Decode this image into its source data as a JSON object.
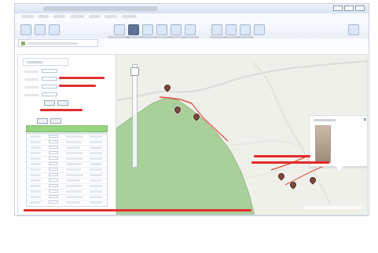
{
  "window": {
    "title": "",
    "menu_items": [
      "",
      "",
      "",
      "",
      "",
      "",
      ""
    ],
    "toolbar_items": [
      "",
      "",
      "",
      "",
      "",
      "",
      "",
      "",
      ""
    ],
    "tabs": [
      ""
    ]
  },
  "left_panel": {
    "heading": "",
    "fields": [
      "",
      "",
      "",
      ""
    ],
    "notes": [
      "",
      "",
      ""
    ],
    "buttons": [
      "",
      "",
      "",
      ""
    ],
    "table_header": "",
    "rows": [
      [
        "",
        "",
        ""
      ],
      [
        "",
        "",
        ""
      ],
      [
        "",
        "",
        ""
      ],
      [
        "",
        "",
        ""
      ],
      [
        "",
        "",
        ""
      ],
      [
        "",
        "",
        ""
      ],
      [
        "",
        "",
        ""
      ],
      [
        "",
        "",
        ""
      ],
      [
        "",
        "",
        ""
      ],
      [
        "",
        "",
        ""
      ],
      [
        "",
        "",
        ""
      ],
      [
        "",
        "",
        ""
      ],
      [
        "",
        "",
        ""
      ]
    ]
  },
  "map": {
    "popup_title": "",
    "annotations": [
      "",
      ""
    ],
    "attribution": ""
  },
  "footer_note": "",
  "colors": {
    "map_green": "#a9cf9b",
    "route_red": "#df4f43",
    "note_red": "#e32a2a",
    "list_green": "#97d57f",
    "marker_brown": "#7b4a3f"
  }
}
